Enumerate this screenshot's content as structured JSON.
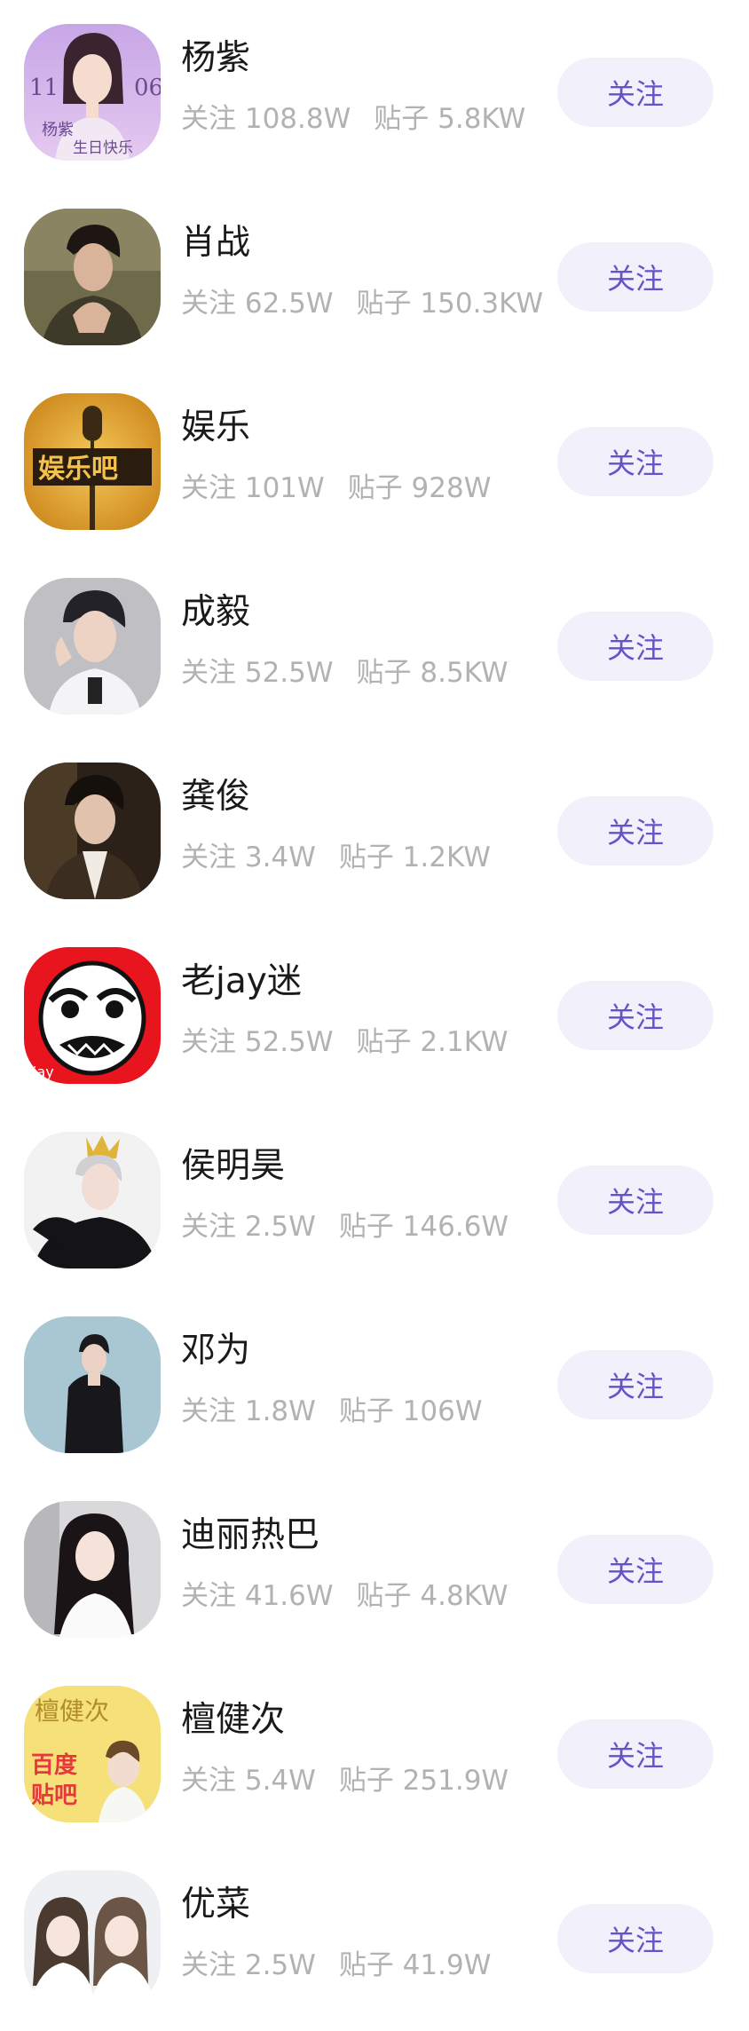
{
  "follow_label": "关注",
  "rows": [
    {
      "name": "杨紫",
      "followers_label": "关注",
      "followers": "108.8W",
      "posts_label": "贴子",
      "posts": "5.8KW",
      "avatar_text": "11 06 杨紫 生日快乐"
    },
    {
      "name": "肖战",
      "followers_label": "关注",
      "followers": "62.5W",
      "posts_label": "贴子",
      "posts": "150.3KW"
    },
    {
      "name": "娱乐",
      "followers_label": "关注",
      "followers": "101W",
      "posts_label": "贴子",
      "posts": "928W",
      "avatar_text": "娱乐吧"
    },
    {
      "name": "成毅",
      "followers_label": "关注",
      "followers": "52.5W",
      "posts_label": "贴子",
      "posts": "8.5KW"
    },
    {
      "name": "龚俊",
      "followers_label": "关注",
      "followers": "3.4W",
      "posts_label": "贴子",
      "posts": "1.2KW"
    },
    {
      "name": "老jay迷",
      "followers_label": "关注",
      "followers": "52.5W",
      "posts_label": "贴子",
      "posts": "2.1KW",
      "avatar_text": "jay"
    },
    {
      "name": "侯明昊",
      "followers_label": "关注",
      "followers": "2.5W",
      "posts_label": "贴子",
      "posts": "146.6W"
    },
    {
      "name": "邓为",
      "followers_label": "关注",
      "followers": "1.8W",
      "posts_label": "贴子",
      "posts": "106W"
    },
    {
      "name": "迪丽热巴",
      "followers_label": "关注",
      "followers": "41.6W",
      "posts_label": "贴子",
      "posts": "4.8KW"
    },
    {
      "name": "檀健次",
      "followers_label": "关注",
      "followers": "5.4W",
      "posts_label": "贴子",
      "posts": "251.9W",
      "avatar_text": "檀健次 百度贴吧"
    },
    {
      "name": "优菜",
      "followers_label": "关注",
      "followers": "2.5W",
      "posts_label": "贴子",
      "posts": "41.9W"
    }
  ],
  "colors": {
    "name": "#1a1a1a",
    "stats": "#b2b2b2",
    "follow_bg": "#f1f0fb",
    "follow_text": "#6652c9"
  }
}
